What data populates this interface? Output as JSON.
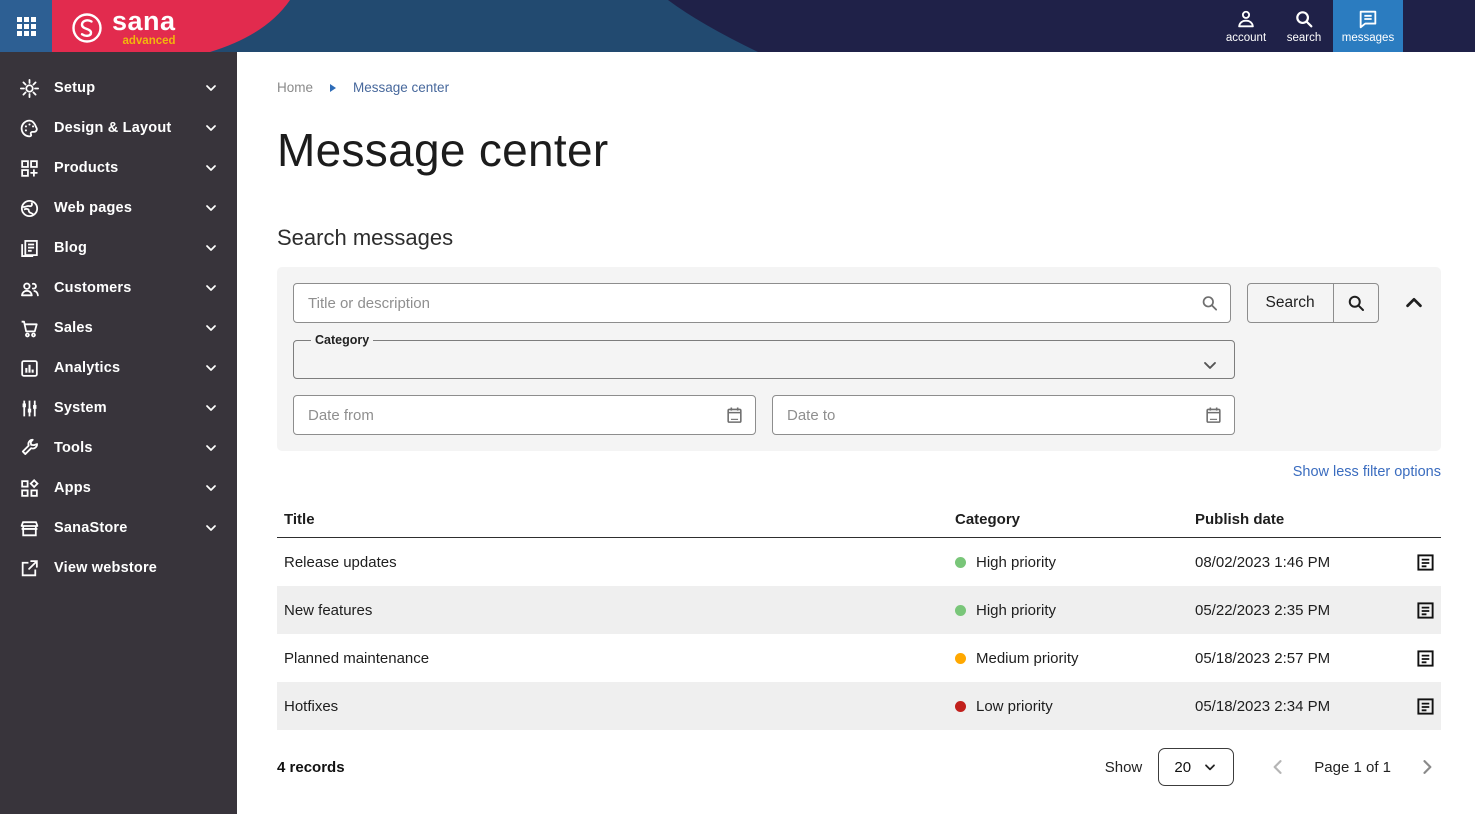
{
  "topbar": {
    "brand": "sana",
    "brand_sub": "advanced",
    "nav": [
      {
        "label": "account"
      },
      {
        "label": "search"
      },
      {
        "label": "messages"
      }
    ]
  },
  "sidebar": {
    "items": [
      {
        "label": "Setup"
      },
      {
        "label": "Design & Layout"
      },
      {
        "label": "Products"
      },
      {
        "label": "Web pages"
      },
      {
        "label": "Blog"
      },
      {
        "label": "Customers"
      },
      {
        "label": "Sales"
      },
      {
        "label": "Analytics"
      },
      {
        "label": "System"
      },
      {
        "label": "Tools"
      },
      {
        "label": "Apps"
      },
      {
        "label": "SanaStore"
      },
      {
        "label": "View webstore"
      }
    ]
  },
  "breadcrumb": {
    "home": "Home",
    "current": "Message center"
  },
  "page": {
    "title": "Message center",
    "section_heading": "Search messages"
  },
  "filters": {
    "title_placeholder": "Title or description",
    "search_label": "Search",
    "category_label": "Category",
    "date_from_placeholder": "Date from",
    "date_to_placeholder": "Date to",
    "toggle_link": "Show less filter options"
  },
  "table": {
    "columns": {
      "title": "Title",
      "category": "Category",
      "publish_date": "Publish date"
    },
    "rows": [
      {
        "title": "Release updates",
        "category": "High priority",
        "priority_color": "#79c679",
        "publish_date": "08/02/2023 1:46 PM"
      },
      {
        "title": "New features",
        "category": "High priority",
        "priority_color": "#79c679",
        "publish_date": "05/22/2023 2:35 PM"
      },
      {
        "title": "Planned maintenance",
        "category": "Medium priority",
        "priority_color": "#ffa800",
        "publish_date": "05/18/2023 2:57 PM"
      },
      {
        "title": "Hotfixes",
        "category": "Low priority",
        "priority_color": "#c1201c",
        "publish_date": "05/18/2023 2:34 PM"
      }
    ]
  },
  "footer": {
    "records": "4 records",
    "show_label": "Show",
    "page_size": "20",
    "page_info": "Page 1 of 1"
  },
  "colors": {
    "topbar_navy": "#1f2148",
    "topbar_steel": "#224a70",
    "apps_square_blue": "#2d5f93",
    "brand_red": "#e22b4e",
    "brand_gold": "#f2b50d",
    "active_tile_blue": "#2b7cc0",
    "sidebar_bg": "#38343b",
    "link_blue": "#3a6cbf",
    "panel_gray": "#f4f4f4",
    "row_alt_gray": "#efefef",
    "priority_high": "#79c679",
    "priority_medium": "#ffa800",
    "priority_low": "#c1201c"
  }
}
